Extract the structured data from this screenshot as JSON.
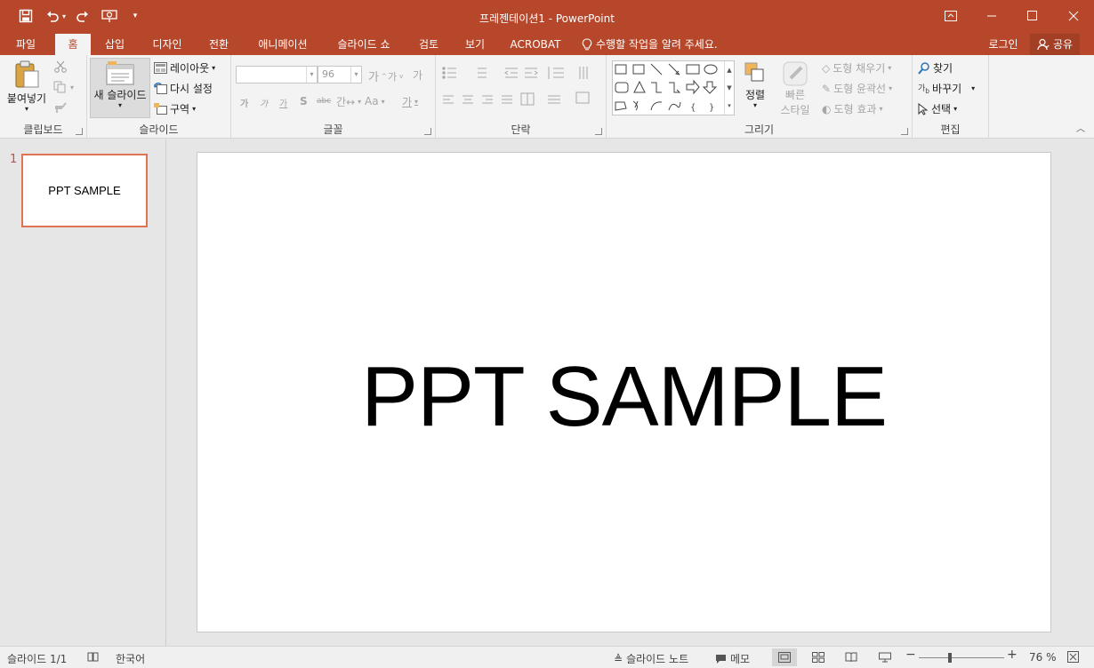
{
  "title_bar": {
    "title": "프레젠테이션1 - PowerPoint",
    "quick_access": [
      "save-icon",
      "undo-icon",
      "redo-icon",
      "start-from-beginning-icon",
      "customize-icon"
    ],
    "window_buttons": [
      "ribbon-display-options-icon",
      "minimize-icon",
      "maximize-icon",
      "close-icon"
    ]
  },
  "tabs": [
    {
      "label": "파일"
    },
    {
      "label": "홈",
      "active": true
    },
    {
      "label": "삽입"
    },
    {
      "label": "디자인"
    },
    {
      "label": "전환"
    },
    {
      "label": "애니메이션"
    },
    {
      "label": "슬라이드 쇼"
    },
    {
      "label": "검토"
    },
    {
      "label": "보기"
    },
    {
      "label": "ACROBAT"
    }
  ],
  "tell_me": "수행할 작업을 알려 주세요.",
  "signin": "로그인",
  "share": "공유",
  "ribbon": {
    "clipboard": {
      "label": "클립보드",
      "paste": "붙여넣기"
    },
    "slides": {
      "label": "슬라이드",
      "new_slide": "새 슬라이드",
      "layout": "레이아웃",
      "reset": "다시 설정",
      "section": "구역"
    },
    "font": {
      "label": "글꼴",
      "font_name": "",
      "font_size": "96"
    },
    "paragraph": {
      "label": "단락"
    },
    "drawing": {
      "label": "그리기",
      "arrange": "정렬",
      "quick_styles": "빠른 스타일",
      "quick_styles_l1": "빠른",
      "quick_styles_l2": "스타일",
      "shape_fill": "도형 채우기",
      "shape_outline": "도형 윤곽선",
      "shape_effects": "도형 효과"
    },
    "editing": {
      "label": "편집",
      "find": "찾기",
      "replace": "바꾸기",
      "select": "선택"
    }
  },
  "slides_panel": {
    "number": "1",
    "thumbnail_text": "PPT SAMPLE"
  },
  "slide": {
    "title": "PPT SAMPLE"
  },
  "status": {
    "slide_counter": "슬라이드 1/1",
    "language": "한국어",
    "notes": "슬라이드 노트",
    "comments": "메모",
    "zoom": "76 %",
    "zoom_level": 0.76
  },
  "colors": {
    "accent": "#b7472a",
    "selection_border": "#e07354"
  }
}
